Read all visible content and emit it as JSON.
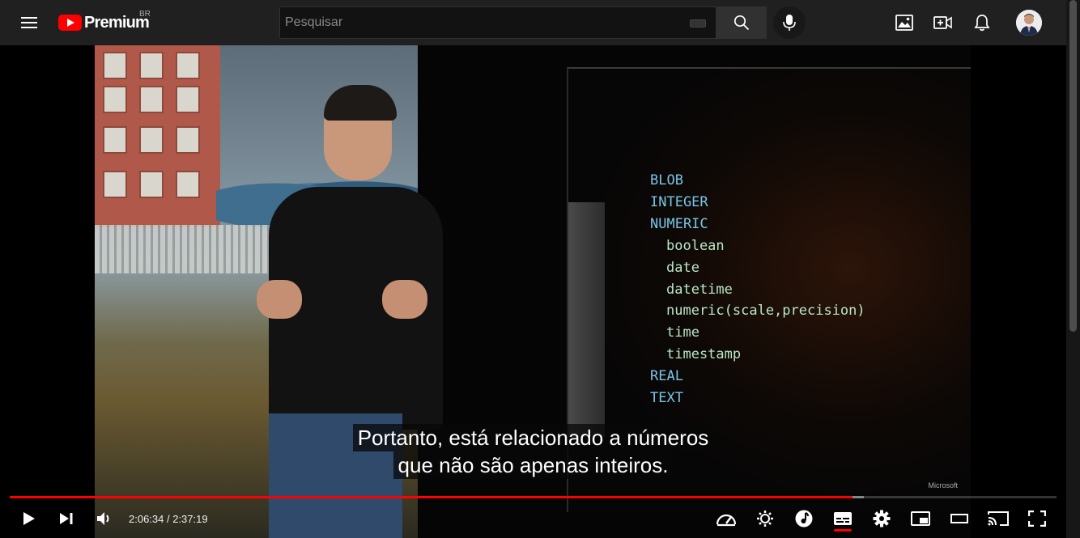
{
  "masthead": {
    "logo_text": "Premium",
    "country_code": "BR",
    "search_placeholder": "Pesquisar"
  },
  "video": {
    "slide_lines": [
      {
        "text": "BLOB",
        "kind": "type"
      },
      {
        "text": "INTEGER",
        "kind": "type"
      },
      {
        "text": "NUMERIC",
        "kind": "type"
      },
      {
        "text": "boolean",
        "kind": "subtype"
      },
      {
        "text": "date",
        "kind": "subtype"
      },
      {
        "text": "datetime",
        "kind": "subtype"
      },
      {
        "text": "numeric(scale,precision)",
        "kind": "subtype"
      },
      {
        "text": "time",
        "kind": "subtype"
      },
      {
        "text": "timestamp",
        "kind": "subtype"
      },
      {
        "text": "REAL",
        "kind": "type"
      },
      {
        "text": "TEXT",
        "kind": "type"
      }
    ],
    "slide_brand": "Microsoft",
    "captions": [
      "Portanto, está relacionado a números",
      "que não são apenas inteiros."
    ]
  },
  "player": {
    "current_time": "2:06:34",
    "duration": "2:37:19",
    "time_display": "2:06:34 / 2:37:19",
    "progress_played_fraction": 0.805,
    "progress_buffered_fraction": 0.816,
    "subtitles_on": true
  },
  "colors": {
    "accent": "#ff0000",
    "type_keyword": "#7ac4e6",
    "subtype_keyword": "#b9e6c6"
  },
  "icons": {
    "top": [
      "menu-icon",
      "youtube-logo-icon",
      "keyboard-icon",
      "search-icon",
      "mic-icon",
      "image-icon",
      "create-video-icon",
      "bell-icon"
    ],
    "controls": [
      "play-icon",
      "next-icon",
      "volume-icon",
      "speed-icon",
      "ambient-settings-icon",
      "music-icon",
      "subtitles-icon",
      "settings-gear-icon",
      "miniplayer-icon",
      "theater-mode-icon",
      "cast-icon",
      "fullscreen-icon"
    ]
  }
}
